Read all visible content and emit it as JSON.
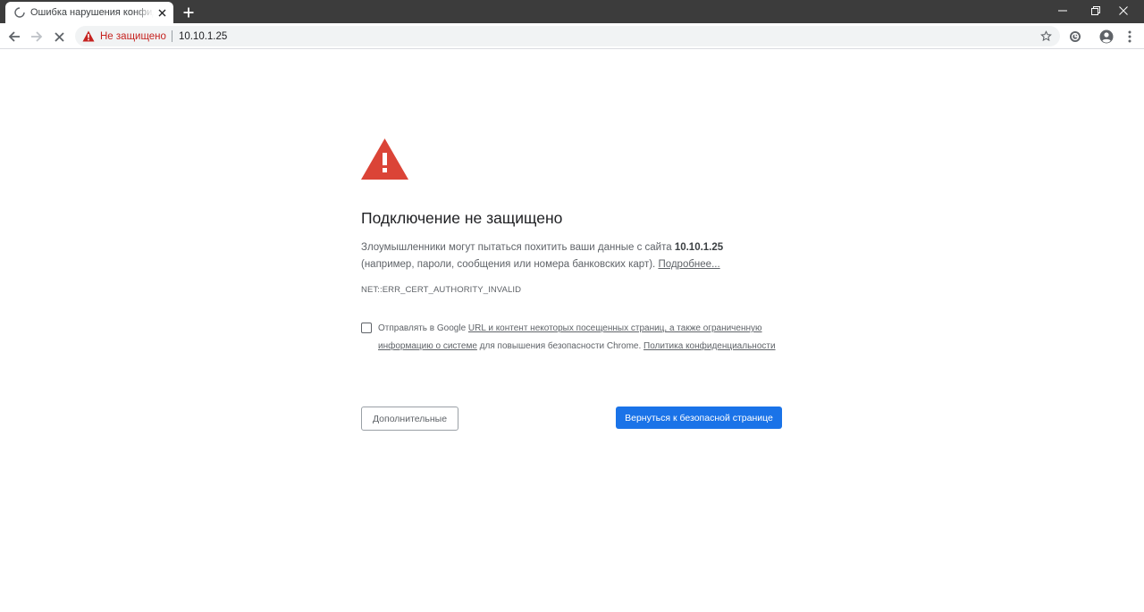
{
  "tab": {
    "title": "Ошибка нарушения конфиденциальности",
    "icon": "loading-spinner-icon"
  },
  "window_controls": [
    "minimize-icon",
    "restore-icon",
    "close-icon"
  ],
  "omnibox": {
    "security_label": "Не защищено",
    "url": "10.10.1.25"
  },
  "interstitial": {
    "heading": "Подключение не защищено",
    "desc_prefix": "Злоумышленники могут пытаться похитить ваши данные с сайта ",
    "desc_host": "10.10.1.25",
    "desc_suffix": " (например, пароли, сообщения или номера банковских карт). ",
    "learn_more": "Подробнее...",
    "error_code": "NET::ERR_CERT_AUTHORITY_INVALID",
    "report_prefix": "Отправлять в Google ",
    "report_link1": "URL и контент некоторых посещенных страниц, а также ограниченную информацию о системе",
    "report_middle": " для повышения безопасности Chrome. ",
    "report_link2": "Политика конфиденциальности",
    "advanced_button": "Дополнительные",
    "back_button": "Вернуться к безопасной странице"
  },
  "colors": {
    "danger": "#db4437",
    "primary": "#1a73e8",
    "tabstrip": "#3c3c3c"
  }
}
